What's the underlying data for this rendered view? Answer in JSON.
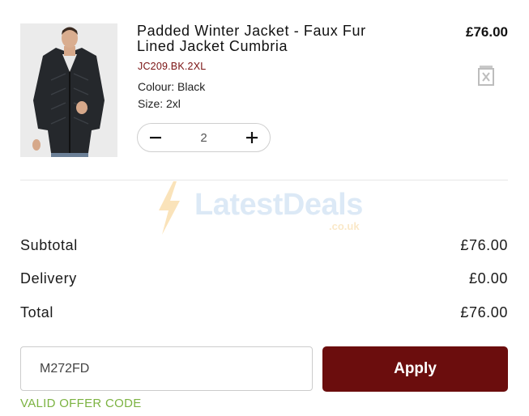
{
  "product": {
    "title_line1": "Padded Winter Jacket - Faux Fur",
    "title_line2": "Lined Jacket Cumbria",
    "sku": "JC209.BK.2XL",
    "colour": "Colour: Black",
    "size": "Size: 2xl",
    "price": "£76.00",
    "quantity": "2",
    "image_icon": "product-photo-man-black-padded-jacket"
  },
  "watermark": {
    "brand": "LatestDeals",
    "domain": ".co.uk",
    "icon": "lightning-bolt-icon"
  },
  "summary": {
    "subtotal_label": "Subtotal",
    "subtotal_value": "£76.00",
    "delivery_label": "Delivery",
    "delivery_value": "£0.00",
    "total_label": "Total",
    "total_value": "£76.00"
  },
  "offer": {
    "code_value": "M272FD",
    "apply_label": "Apply",
    "status": "VALID OFFER CODE"
  },
  "colors": {
    "accent": "#6b0d0d",
    "sku": "#7a1212",
    "valid": "#7cb342"
  }
}
